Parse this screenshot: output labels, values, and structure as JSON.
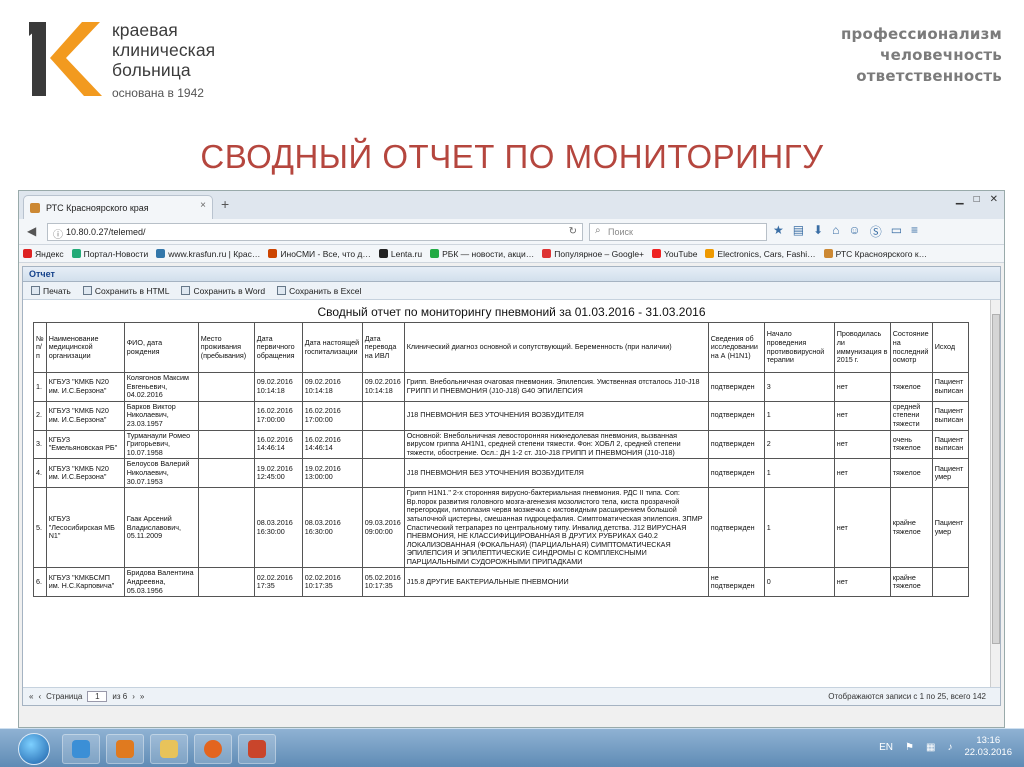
{
  "slide": {
    "logo_text": "К",
    "hospital_name": [
      "краевая",
      "клиническая",
      "больница"
    ],
    "founded": "основана в 1942",
    "values": [
      "профессионализм",
      "человечность",
      "ответственность"
    ],
    "title": "СВОДНЫЙ ОТЧЕТ ПО МОНИТОРИНГУ"
  },
  "browser": {
    "tab_title": "РТС Красноярского края",
    "url": "10.80.0.27/telemed/",
    "search_placeholder": "Поиск",
    "bookmarks": [
      {
        "label": "Яндекс",
        "color": "#d22"
      },
      {
        "label": "Портал-Новости",
        "color": "#2a7"
      },
      {
        "label": "www.krasfun.ru | Крас…",
        "color": "#37a"
      },
      {
        "label": "ИноСМИ - Все, что д…",
        "color": "#c40"
      },
      {
        "label": "Lenta.ru",
        "color": "#222"
      },
      {
        "label": "РБК — новости, акци…",
        "color": "#2a4"
      },
      {
        "label": "Популярное – Google+",
        "color": "#d33"
      },
      {
        "label": "YouTube",
        "color": "#e22"
      },
      {
        "label": "Electronics, Cars, Fashi…",
        "color": "#e90"
      },
      {
        "label": "РТС Красноярского к…",
        "color": "#c83"
      }
    ]
  },
  "app": {
    "window_title": "Отчет",
    "toolbar": [
      "Печать",
      "Сохранить в HTML",
      "Сохранить в Word",
      "Сохранить в Excel"
    ],
    "report_title": "Сводный отчет по мониторингу пневмоний за 01.03.2016 - 31.03.2016",
    "columns": [
      "№ п/п",
      "Наименование медицинской организации",
      "ФИО, дата рождения",
      "Место проживания (пребывания)",
      "Дата первичного обращения",
      "Дата настоящей госпитализации",
      "Дата перевода на ИВЛ",
      "Клинический диагноз основной и сопутствующий. Беременность (при наличии)",
      "Сведения об исследовании на А (H1N1)",
      "Начало проведения противовирусной терапии",
      "Проводилась ли иммунизация в 2015 г.",
      "Состояние на последний осмотр",
      "Исход"
    ],
    "rows": [
      {
        "num": "1.",
        "org": "КГБУЗ \"КМКБ N20 им. И.С.Берзона\"",
        "fio": "Колягонов Максим Евгеньевич, 04.02.2016",
        "place": "",
        "d1": "09.02.2016 10:14:18",
        "d2": "09.02.2016 10:14:18",
        "d3": "09.02.2016 10:14:18",
        "diag": "Грипп. Внебольничная очаговая пневмония. Эпилепсия. Умственная отсталось J10-J18 ГРИПП И ПНЕВМОНИЯ (J10-J18) G40 ЭПИЛЕПСИЯ",
        "h1n1": "подтвержден",
        "start": "3",
        "immun": "нет",
        "state": "тяжелое",
        "outcome": "Пациент выписан"
      },
      {
        "num": "2.",
        "org": "КГБУЗ \"КМКБ N20 им. И.С.Берзона\"",
        "fio": "Барков Виктор Николаевич, 23.03.1957",
        "place": "",
        "d1": "16.02.2016 17:00:00",
        "d2": "16.02.2016 17:00:00",
        "d3": "",
        "diag": "J18 ПНЕВМОНИЯ БЕЗ УТОЧНЕНИЯ ВОЗБУДИТЕЛЯ",
        "h1n1": "подтвержден",
        "start": "1",
        "immun": "нет",
        "state": "средней степени тяжести",
        "outcome": "Пациент выписан"
      },
      {
        "num": "3.",
        "org": "КГБУЗ \"Емельяновская РБ\"",
        "fio": "Турманаули Ромео Григорьевич, 10.07.1958",
        "place": "",
        "d1": "16.02.2016 14:46:14",
        "d2": "16.02.2016 14:46:14",
        "d3": "",
        "diag": "Основной: Внебольничная левосторонняя нижнедолевая пневмония, вызванная вирусом гриппа AH1N1, средней степени тяжести. Фон: ХОБЛ 2, средней степени тяжести, обострение. Осл.: ДН 1-2 ст. J10-J18 ГРИПП И ПНЕВМОНИЯ (J10-J18)",
        "h1n1": "подтвержден",
        "start": "2",
        "immun": "нет",
        "state": "очень тяжелое",
        "outcome": "Пациент выписан"
      },
      {
        "num": "4.",
        "org": "КГБУЗ \"КМКБ N20 им. И.С.Берзона\"",
        "fio": "Белоусов Валерий Николаевич, 30.07.1953",
        "place": "",
        "d1": "19.02.2016 12:45:00",
        "d2": "19.02.2016 13:00:00",
        "d3": "",
        "diag": "J18 ПНЕВМОНИЯ БЕЗ УТОЧНЕНИЯ ВОЗБУДИТЕЛЯ",
        "h1n1": "подтвержден",
        "start": "1",
        "immun": "нет",
        "state": "тяжелое",
        "outcome": "Пациент умер"
      },
      {
        "num": "5.",
        "org": "КГБУЗ \"Лесосибирская МБ N1\"",
        "fio": "Гаак Арсений Владиславович, 05.11.2009",
        "place": "",
        "d1": "08.03.2016 16:30:00",
        "d2": "08.03.2016 16:30:00",
        "d3": "09.03.2016 09:00:00",
        "diag": "Грипп H1N1.\" 2-х сторонняя вирусно-бактериальная пневмония. РДС II типа. Соп: Вр.порок развития головного мозга-агенезия мозолистого тела, киста прозрачной перегородки, гипоплазия червя мозжечка с кистовидным расширением большой затылочной цистерны, смешанная гидроцефалия. Симптоматическая эпилепсия. ЗПМР Спастический тетрапарез по центральному типу. Инвалид детства. J12 ВИРУСНАЯ ПНЕВМОНИЯ, НЕ КЛАССИФИЦИРОВАННАЯ В ДРУГИХ РУБРИКАХ G40.2 ЛОКАЛИЗОВАННАЯ (ФОКАЛЬНАЯ) (ПАРЦИАЛЬНАЯ) СИМПТОМАТИЧЕСКАЯ ЭПИЛЕПСИЯ И ЭПИЛЕПТИЧЕСКИЕ СИНДРОМЫ С КОМПЛЕКСНЫМИ ПАРЦИАЛЬНЫМИ СУДОРОЖНЫМИ ПРИПАДКАМИ",
        "h1n1": "подтвержден",
        "start": "1",
        "immun": "нет",
        "state": "крайне тяжелое",
        "outcome": "Пациент умер"
      },
      {
        "num": "6.",
        "org": "КГБУЗ \"КМКБСМП им. Н.С.Карповича\"",
        "fio": "Бридова Валентина Андреевна, 05.03.1956",
        "place": "",
        "d1": "02.02.2016 17:35",
        "d2": "02.02.2016 10:17:35",
        "d3": "05.02.2016 10:17:35",
        "diag": "J15.8 ДРУГИЕ БАКТЕРИАЛЬНЫЕ ПНЕВМОНИИ",
        "h1n1": "не подтвержден",
        "start": "0",
        "immun": "нет",
        "state": "крайне тяжелое",
        "outcome": ""
      }
    ],
    "pager": {
      "page_label": "Страница",
      "page": "1",
      "of": "из 6",
      "status": "Отображаются записи с 1 по 25, всего 142"
    }
  },
  "taskbar": {
    "lang": "EN",
    "time": "13:16",
    "date": "22.03.2016"
  }
}
